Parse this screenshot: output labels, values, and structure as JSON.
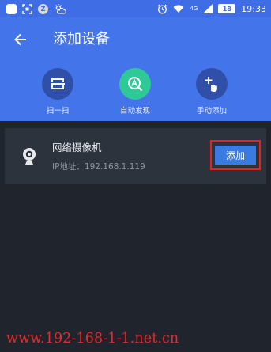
{
  "status_bar": {
    "battery": "18",
    "network": "4G",
    "time": "19:33",
    "icons": [
      "app-square-icon",
      "screenshot-icon",
      "z-badge-icon",
      "weather-icon",
      "alarm-icon",
      "wifi-icon",
      "signal-icon",
      "battery-icon"
    ]
  },
  "header": {
    "title": "添加设备",
    "background": "#4374ea",
    "actions": [
      {
        "label": "扫一扫",
        "icon": "scan-icon",
        "color": "#2f4fa8"
      },
      {
        "label": "自动发现",
        "icon": "auto-discover-icon",
        "color": "#2ec997"
      },
      {
        "label": "手动添加",
        "icon": "manual-add-icon",
        "color": "#2f4fa8"
      }
    ]
  },
  "device": {
    "name": "网络摄像机",
    "ip": "IP地址：192.168.1.119",
    "add_label": "添加",
    "icon": "camera-icon"
  },
  "watermark": "www.192-168-1-1.net.cn"
}
